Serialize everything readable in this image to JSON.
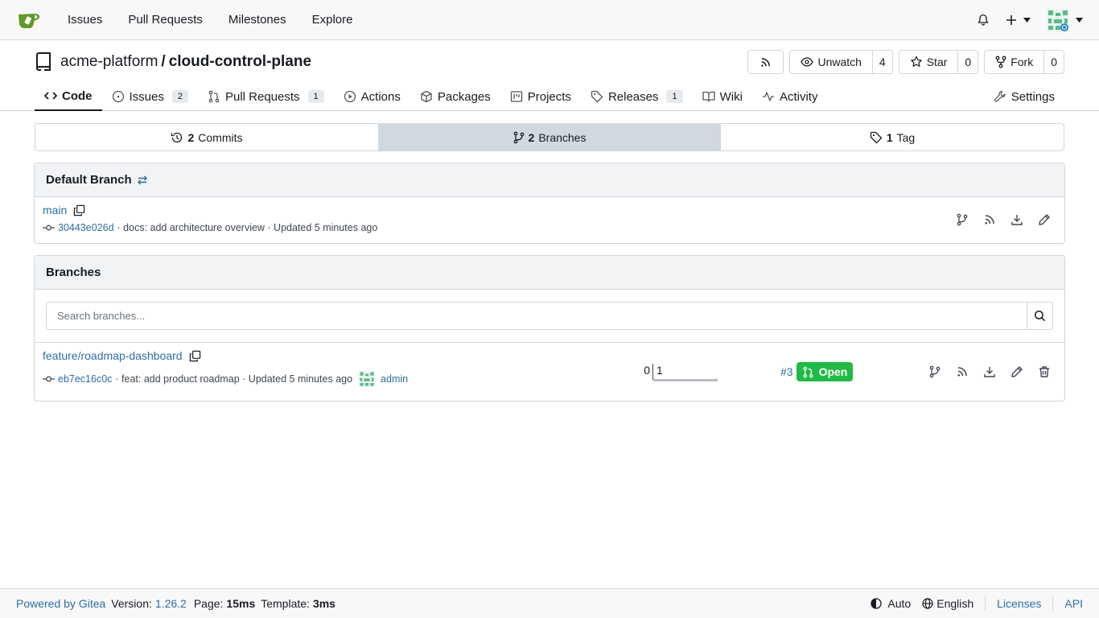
{
  "nav": {
    "items": [
      "Issues",
      "Pull Requests",
      "Milestones",
      "Explore"
    ],
    "icons": [
      "gitea-logo-icon",
      "bell-icon",
      "plus-icon",
      "avatar"
    ],
    "brand_color": "#609926"
  },
  "repo": {
    "owner": "acme-platform",
    "separator": "/",
    "name": "cloud-control-plane",
    "watch_label": "Unwatch",
    "watch_count": "4",
    "star_label": "Star",
    "star_count": "0",
    "fork_label": "Fork",
    "fork_count": "0"
  },
  "tabs": {
    "code": "Code",
    "issues": "Issues",
    "issues_count": "2",
    "pulls": "Pull Requests",
    "pulls_count": "1",
    "actions": "Actions",
    "packages": "Packages",
    "projects": "Projects",
    "releases": "Releases",
    "releases_count": "1",
    "wiki": "Wiki",
    "activity": "Activity",
    "settings": "Settings"
  },
  "stats": {
    "commits_num": "2",
    "commits_label": "Commits",
    "branches_num": "2",
    "branches_label": "Branches",
    "tags_num": "1",
    "tags_label": "Tag"
  },
  "default_branch": {
    "heading": "Default Branch",
    "name": "main",
    "sha": "30443e026d",
    "message": "· docs: add architecture overview · Updated 5 minutes ago"
  },
  "branches": {
    "heading": "Branches",
    "search_placeholder": "Search branches...",
    "items": [
      {
        "name": "feature/roadmap-dashboard",
        "sha": "eb7ec16c0c",
        "message": "· feat: add product roadmap · Updated 5 minutes ago",
        "author": "admin",
        "behind": "0",
        "ahead": "1",
        "pr_number": "#3",
        "pr_state": "Open"
      }
    ]
  },
  "footer": {
    "powered": "Powered by Gitea",
    "version_label": "Version:",
    "version": "1.26.2",
    "page_label": "Page:",
    "page_time": "15ms",
    "template_label": "Template:",
    "template_time": "3ms",
    "theme": "Auto",
    "language": "English",
    "licenses": "Licenses",
    "api": "API"
  },
  "colors": {
    "link": "#2e6da4",
    "open_badge": "#21ba45",
    "active_stat": "#d0d9e0"
  }
}
